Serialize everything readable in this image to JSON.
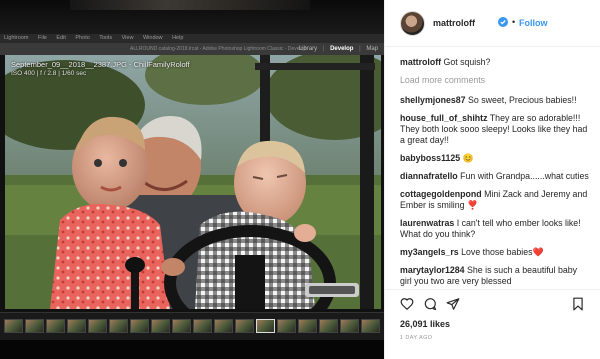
{
  "lightroom": {
    "menu_items": [
      "Lightroom",
      "File",
      "Edit",
      "Photo",
      "Tools",
      "View",
      "Window",
      "Help"
    ],
    "window_title": "ALLROUND catalog-2018.lrcat - Adobe Photoshop Lightroom Classic - Develop",
    "modules": [
      "Library",
      "Develop",
      "Map"
    ],
    "active_module": "Develop",
    "caption_line1": "September_09__2018__2387.JPG - ChillFamilyRoloff",
    "caption_line2": "ISO 400 | f / 2.8 | 1/60 sec"
  },
  "post": {
    "username": "mattroloff",
    "follow_label": "Follow",
    "header_separator": "•",
    "caption_user": "mattroloff",
    "caption_text": "Got squish?",
    "load_more": "Load more comments",
    "comments": [
      {
        "user": "shellymjones87",
        "text": "So sweet, Precious babies!!"
      },
      {
        "user": "house_full_of_shihtz",
        "text": "They are so adorable!!! They both look sooo sleepy! Looks like they had a great day!!"
      },
      {
        "user": "babyboss1125",
        "text": "😊"
      },
      {
        "user": "diannafratello",
        "text": "Fun with Grandpa......what cuties"
      },
      {
        "user": "cottagegoldenpond",
        "text": "Mini Zack and Jeremy and Ember is smiling ❣️"
      },
      {
        "user": "laurenwatras",
        "text": "I can't tell who ember looks like! What do you think?"
      },
      {
        "user": "my3angels_rs",
        "text": "Love those babies❤️"
      },
      {
        "user": "marytaylor1284",
        "text": "She is such a beautiful baby girl you two are very blessed"
      }
    ],
    "likes": "26,091 likes",
    "age": "1 DAY AGO"
  },
  "colors": {
    "link_blue": "#3897f0",
    "text_dark": "#262626",
    "text_muted": "#999999"
  }
}
